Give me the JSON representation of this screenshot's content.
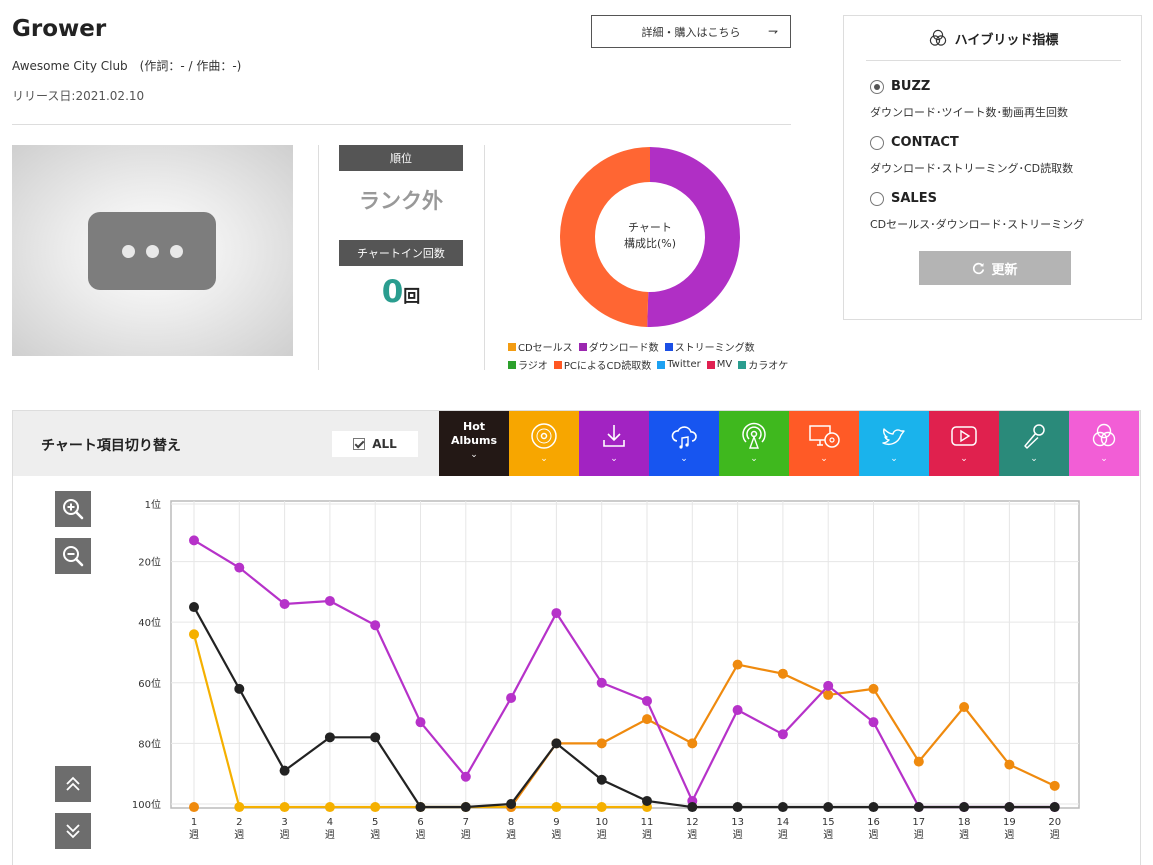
{
  "song": {
    "title": "Grower",
    "artist_line": "Awesome City Club　(作詞：- / 作曲：-)",
    "release": "リリース日:2021.02.10",
    "detail_button": "詳細・購入はこちら",
    "detail_arrow": "⇁"
  },
  "rank": {
    "label": "順位",
    "value": "ランク外",
    "count_label": "チャートイン回数",
    "count": "0",
    "count_unit": "回"
  },
  "donut": {
    "center_line1": "チャート",
    "center_line2": "構成比(%)",
    "slices": [
      {
        "name": "ダウンロード数",
        "percent": 50.5,
        "color": "#b02fc5"
      },
      {
        "name": "PCによるCD読取数",
        "percent": 49.5,
        "color": "#ff6633"
      }
    ]
  },
  "legend": [
    {
      "label": "CDセールス",
      "color": "#f39c12"
    },
    {
      "label": "ダウンロード数",
      "color": "#9b27b0"
    },
    {
      "label": "ストリーミング数",
      "color": "#1b4fe6"
    },
    {
      "label": "ラジオ",
      "color": "#2ca02c"
    },
    {
      "label": "PCによるCD読取数",
      "color": "#ff5722"
    },
    {
      "label": "Twitter",
      "color": "#1da1f2"
    },
    {
      "label": "MV",
      "color": "#e02050"
    },
    {
      "label": "カラオケ",
      "color": "#2a9d8f"
    }
  ],
  "hybrid": {
    "title": "ハイブリッド指標",
    "options": [
      {
        "label": "BUZZ",
        "desc": "ダウンロード･ツイート数･動画再生回数",
        "selected": true
      },
      {
        "label": "CONTACT",
        "desc": "ダウンロード･ストリーミング･CD読取数",
        "selected": false
      },
      {
        "label": "SALES",
        "desc": "CDセールス･ダウンロード･ストリーミング",
        "selected": false
      }
    ],
    "refresh": "更新"
  },
  "chart_switch": {
    "title": "チャート項目切り替え",
    "all_label": "ALL",
    "hot_label_1": "Hot",
    "hot_label_2": "Albums",
    "tabs": [
      {
        "name": "hot-albums",
        "color": "#231815"
      },
      {
        "name": "cd-sales",
        "color": "#f7a600",
        "icon": "cd-icon"
      },
      {
        "name": "download",
        "color": "#a223c2",
        "icon": "download-icon"
      },
      {
        "name": "streaming",
        "color": "#1755f0",
        "icon": "cloud-music-icon"
      },
      {
        "name": "radio",
        "color": "#3fb81e",
        "icon": "radio-antenna-icon"
      },
      {
        "name": "pc-cd-read",
        "color": "#ff5a26",
        "icon": "pc-cd-icon"
      },
      {
        "name": "twitter",
        "color": "#1ab3ec",
        "icon": "twitter-icon"
      },
      {
        "name": "mv",
        "color": "#e0214e",
        "icon": "play-icon"
      },
      {
        "name": "karaoke",
        "color": "#2a8a7a",
        "icon": "microphone-icon"
      },
      {
        "name": "hybrid",
        "color": "#f25ed6",
        "icon": "hybrid-circles-icon"
      }
    ]
  },
  "chart_data": {
    "type": "line",
    "x": [
      "1\n週",
      "2\n週",
      "3\n週",
      "4\n週",
      "5\n週",
      "6\n週",
      "7\n週",
      "8\n週",
      "9\n週",
      "10\n週",
      "11\n週",
      "12\n週",
      "13\n週",
      "14\n週",
      "15\n週",
      "16\n週",
      "17\n週",
      "18\n週",
      "19\n週",
      "20\n週"
    ],
    "y_ticks": [
      "1位",
      "20位",
      "40位",
      "60位",
      "80位",
      "100位"
    ],
    "ylim": [
      1,
      100
    ],
    "y_reversed": true,
    "grid": true,
    "series": [
      {
        "color": "#f5b000",
        "values": [
          44,
          101,
          101,
          101,
          101,
          101,
          101,
          101,
          101,
          101,
          101,
          null,
          null,
          null,
          null,
          null,
          null,
          null,
          null,
          null
        ]
      },
      {
        "color": "#ef8a0e",
        "values": [
          101,
          null,
          null,
          null,
          null,
          null,
          null,
          101,
          80,
          80,
          72,
          80,
          54,
          57,
          64,
          62,
          86,
          68,
          87,
          94
        ]
      },
      {
        "color": "#b632c9",
        "values": [
          13,
          22,
          34,
          33,
          41,
          73,
          91,
          65,
          37,
          60,
          66,
          99,
          69,
          77,
          61,
          73,
          101,
          101,
          101,
          101
        ]
      },
      {
        "color": "#222222",
        "values": [
          35,
          62,
          89,
          78,
          78,
          101,
          101,
          100,
          80,
          92,
          99,
          101,
          101,
          101,
          101,
          101,
          101,
          101,
          101,
          101
        ]
      }
    ]
  }
}
